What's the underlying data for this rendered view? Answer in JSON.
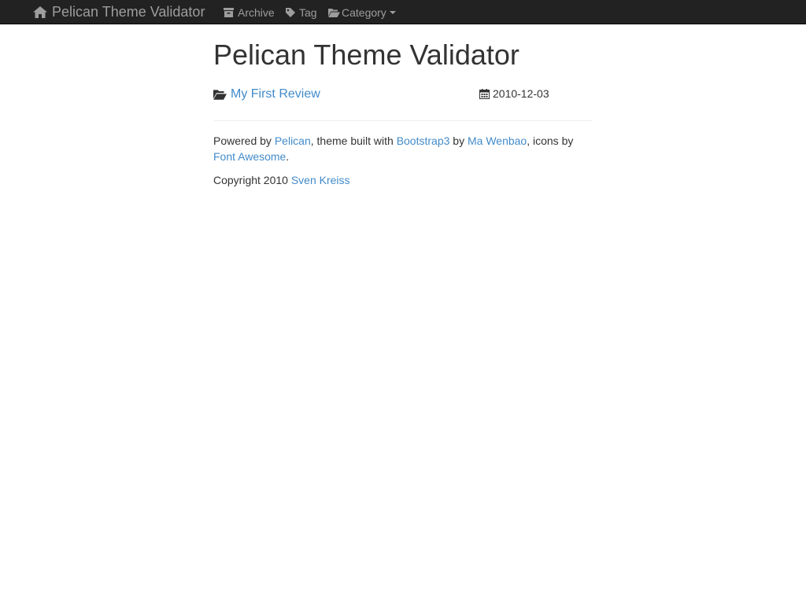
{
  "navbar": {
    "brand": {
      "label": "Pelican Theme Validator",
      "icon": "home-icon"
    },
    "items": [
      {
        "label": "Archive",
        "icon": "archive-icon"
      },
      {
        "label": "Tag",
        "icon": "tag-icon"
      },
      {
        "label": "Category",
        "icon": "folder-open-icon",
        "dropdown": true
      }
    ]
  },
  "main": {
    "title": "Pelican Theme Validator",
    "article": {
      "title": "My First Review",
      "icon": "folder-open-icon",
      "date": "2010-12-03",
      "date_icon": "calendar-icon"
    }
  },
  "footer": {
    "powered_prefix": "Powered by ",
    "pelican_link": "Pelican",
    "theme_text": ", theme built with ",
    "bootstrap_link": "Bootstrap3",
    "by_text": " by ",
    "author_link": "Ma Wenbao",
    "icons_text": ", icons by",
    "fontawesome_link": "Font Awesome",
    "period": ".",
    "copyright_prefix": "Copyright 2010 ",
    "copyright_owner": "Sven Kreiss"
  },
  "colors": {
    "navbar_bg": "#222222",
    "navbar_text": "#9d9d9d",
    "link": "#428bca",
    "text": "#333333",
    "divider": "#eeeeee"
  }
}
